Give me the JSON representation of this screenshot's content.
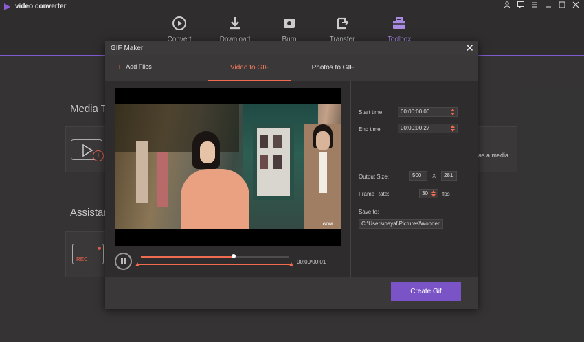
{
  "app": {
    "title": "video converter"
  },
  "window_controls": [
    "user-icon",
    "feedback-icon",
    "menu-icon",
    "minimize-icon",
    "maximize-icon",
    "close-icon"
  ],
  "nav": {
    "items": [
      {
        "label": "Convert",
        "icon": "convert-icon"
      },
      {
        "label": "Download",
        "icon": "download-icon"
      },
      {
        "label": "Burn",
        "icon": "burn-icon"
      },
      {
        "label": "Transfer",
        "icon": "transfer-icon"
      },
      {
        "label": "Toolbox",
        "icon": "toolbox-icon",
        "active": true
      }
    ]
  },
  "background": {
    "media_section_title": "Media Tc",
    "assistant_section_title": "Assistan",
    "card_text": "as a media",
    "rec_label": "REC"
  },
  "modal": {
    "title": "GIF Maker",
    "add_files_label": "Add Files",
    "tabs": [
      {
        "label": "Video to GIF",
        "active": true
      },
      {
        "label": "Photos to GIF",
        "active": false
      }
    ],
    "player": {
      "time_readout": "00:00/00:01",
      "progress": 0.63,
      "watermark": "GOM"
    },
    "settings": {
      "start_time_label": "Start time",
      "start_time_value": "00:00:00.00",
      "end_time_label": "End time",
      "end_time_value": "00:00:00.27",
      "output_size_label": "Output Size:",
      "width_value": "500",
      "size_separator": "X",
      "height_value": "281",
      "frame_rate_label": "Frame Rate:",
      "frame_rate_value": "30",
      "frame_rate_unit": "fps",
      "save_to_label": "Save to:",
      "save_to_value": "C:\\Users\\payal\\Pictures\\Wonder",
      "browse_label": "···"
    },
    "create_button_label": "Create Gif"
  },
  "colors": {
    "accent": "#7a53c7",
    "highlight": "#f26a4f",
    "background": "#3a3839"
  }
}
